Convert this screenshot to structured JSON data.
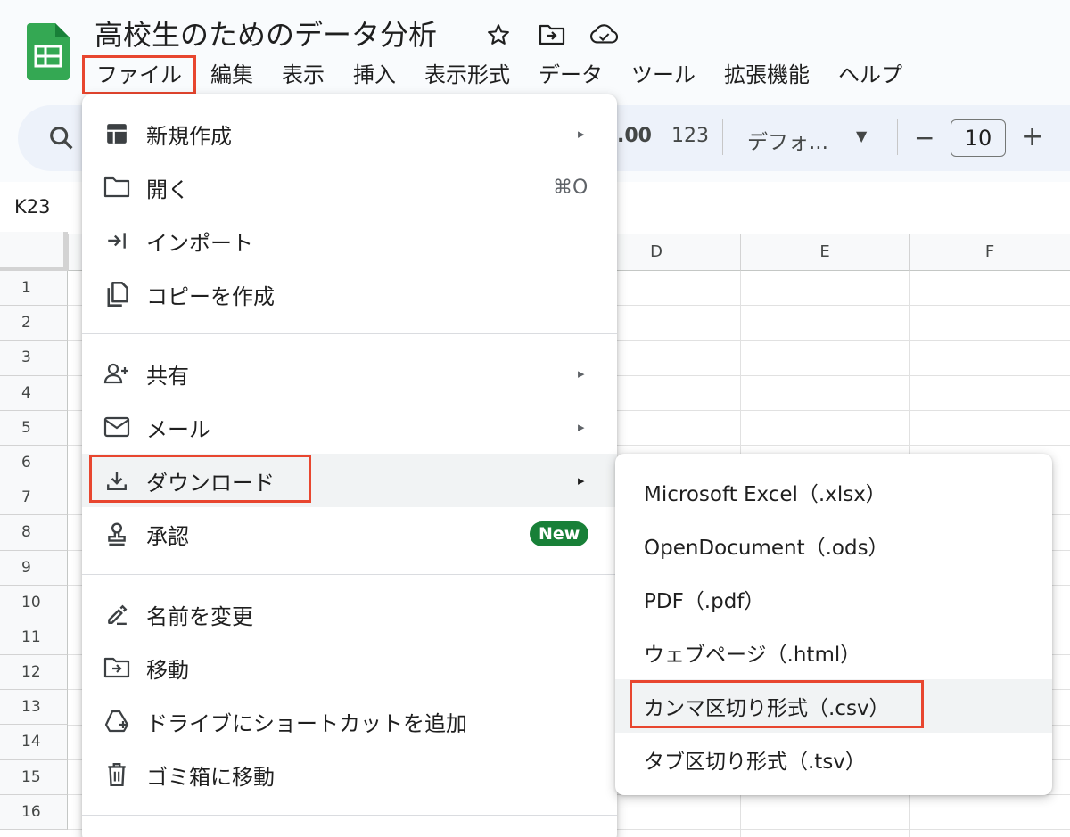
{
  "document": {
    "title": "高校生のためのデータ分析",
    "title_icons": [
      "star-icon",
      "move-to-folder-icon",
      "cloud-saved-icon"
    ]
  },
  "menubar": {
    "items": [
      "ファイル",
      "編集",
      "表示",
      "挿入",
      "表示形式",
      "データ",
      "ツール",
      "拡張機能",
      "ヘルプ"
    ],
    "active": "ファイル"
  },
  "toolbar": {
    "decimal_label": ".00",
    "number_format_label": "123",
    "font_label": "デフォ...",
    "font_size_minus": "−",
    "font_size": "10",
    "font_size_plus": "+"
  },
  "formula_bar": {
    "cell_ref": "K23"
  },
  "sheet": {
    "columns": [
      "D",
      "E",
      "F"
    ],
    "rows": [
      "1",
      "2",
      "3",
      "4",
      "5",
      "6",
      "7",
      "8",
      "9",
      "10",
      "11",
      "12",
      "13",
      "14",
      "15",
      "16"
    ]
  },
  "file_menu": {
    "items": [
      {
        "label": "新規作成",
        "icon": "new-sheet-icon",
        "submenu": true
      },
      {
        "label": "開く",
        "icon": "folder-open-icon",
        "shortcut": "⌘O"
      },
      {
        "label": "インポート",
        "icon": "import-icon"
      },
      {
        "label": "コピーを作成",
        "icon": "copy-icon"
      },
      {
        "label": "共有",
        "icon": "share-person-icon",
        "submenu": true
      },
      {
        "label": "メール",
        "icon": "mail-icon",
        "submenu": true
      },
      {
        "label": "ダウンロード",
        "icon": "download-icon",
        "submenu": true,
        "highlighted": true
      },
      {
        "label": "承認",
        "icon": "approval-stamp-icon",
        "badge": "New"
      },
      {
        "label": "名前を変更",
        "icon": "rename-pencil-icon"
      },
      {
        "label": "移動",
        "icon": "move-folder-icon"
      },
      {
        "label": "ドライブにショートカットを追加",
        "icon": "drive-shortcut-icon"
      },
      {
        "label": "ゴミ箱に移動",
        "icon": "trash-icon"
      }
    ],
    "arrow": "▸"
  },
  "download_submenu": {
    "items": [
      {
        "label": "Microsoft Excel（.xlsx）"
      },
      {
        "label": "OpenDocument（.ods）"
      },
      {
        "label": "PDF（.pdf）"
      },
      {
        "label": "ウェブページ（.html）"
      },
      {
        "label": "カンマ区切り形式（.csv）",
        "highlighted": true
      },
      {
        "label": "タブ区切り形式（.tsv）"
      }
    ]
  },
  "colors": {
    "highlight_box": "#e8462f",
    "badge_green": "#188038",
    "logo_green": "#34a853",
    "toolbar_bg": "#edf2fa"
  }
}
